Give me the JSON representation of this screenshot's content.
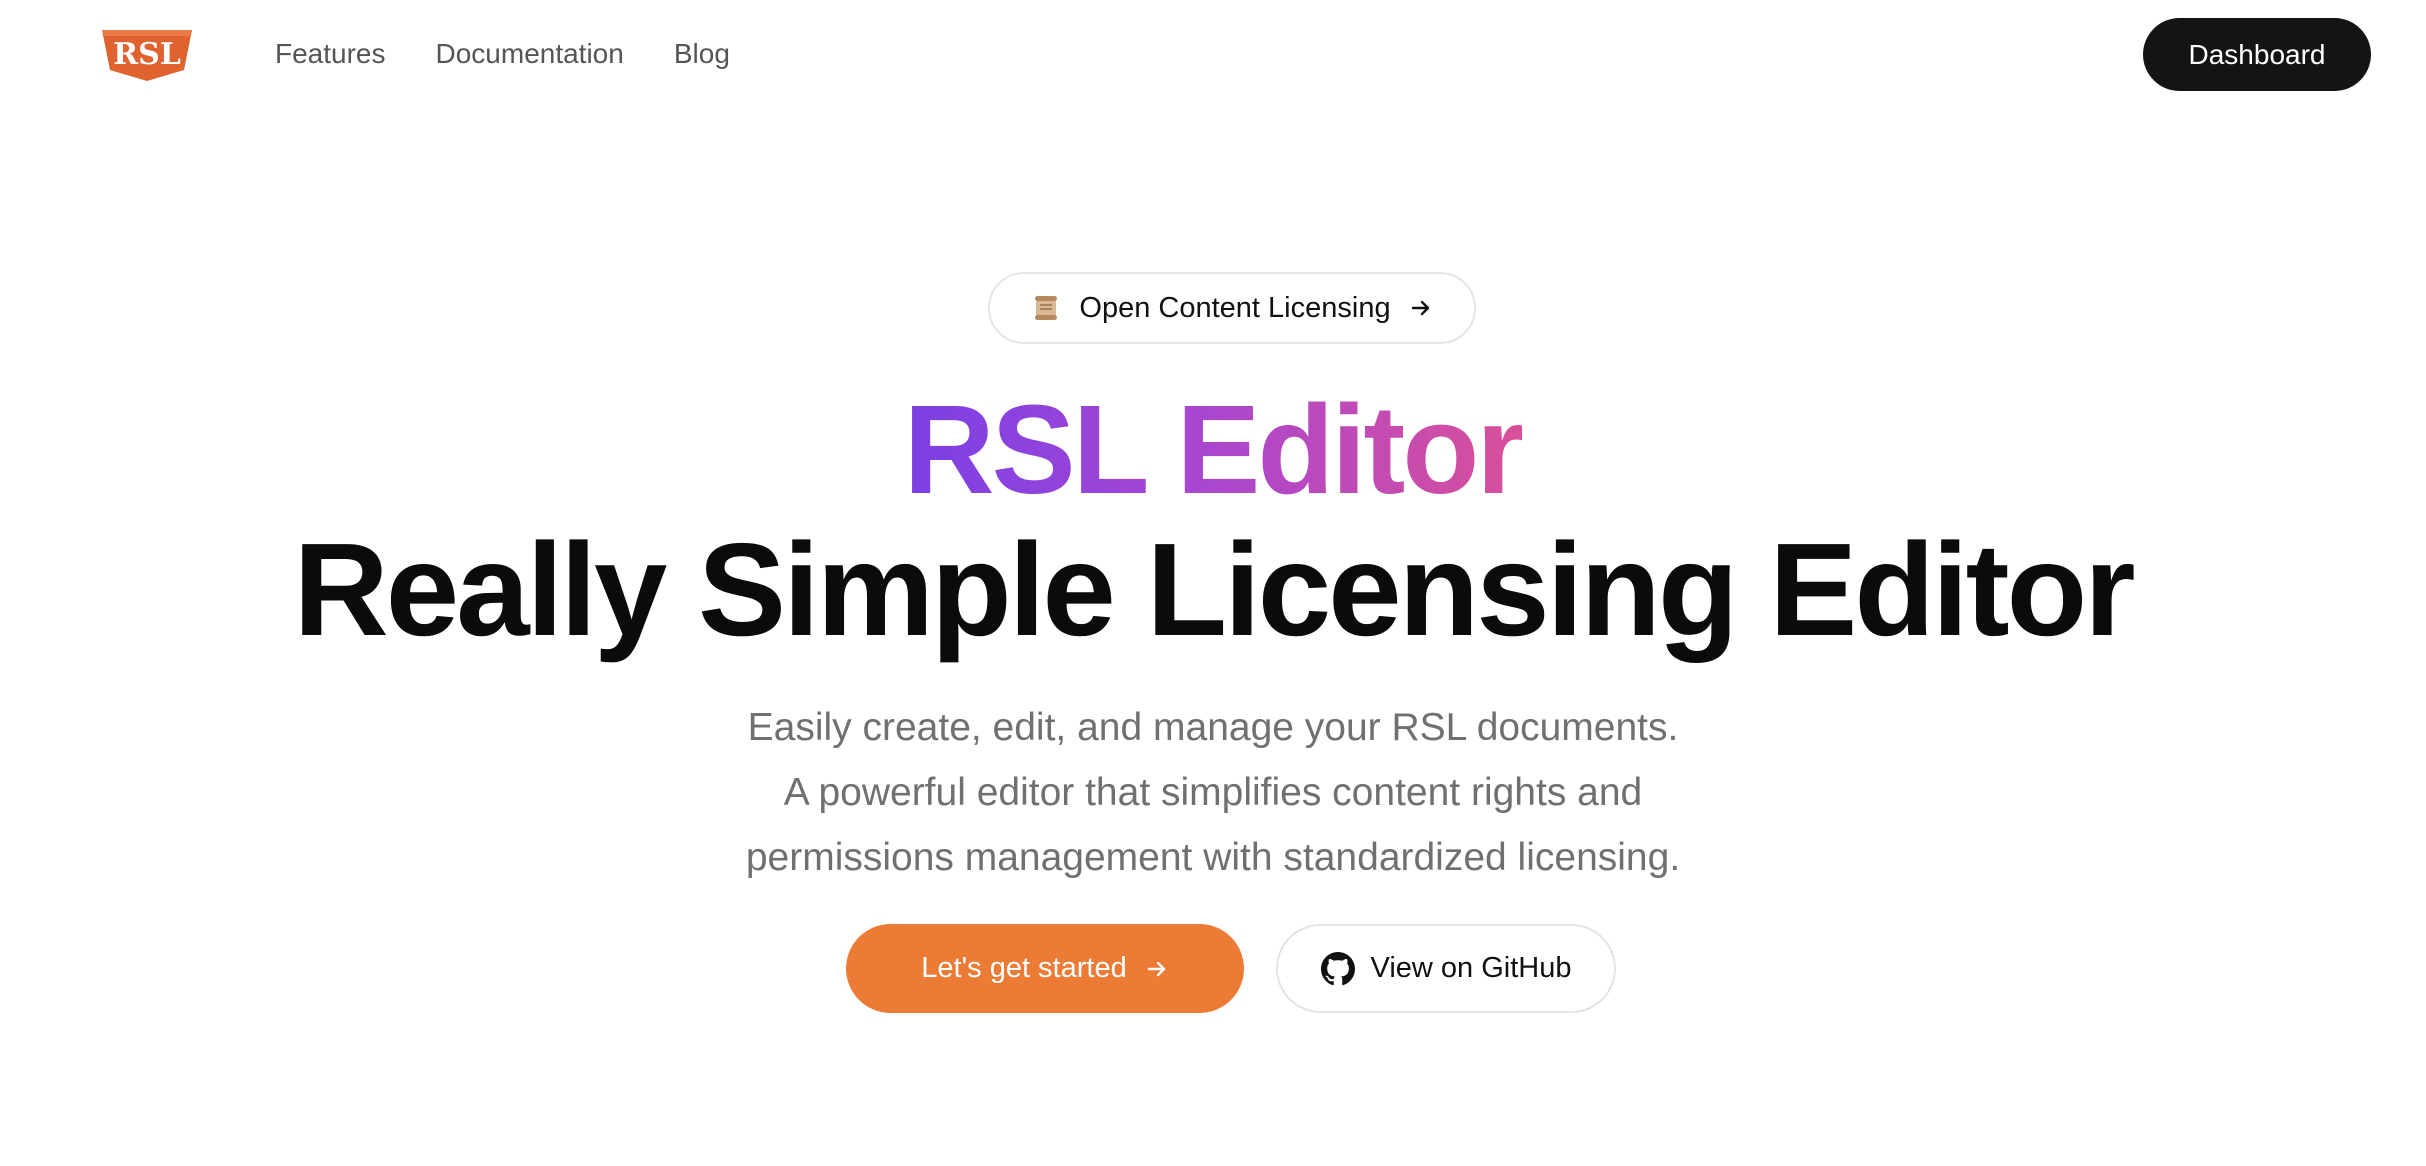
{
  "header": {
    "logo_text": "RSL",
    "nav": [
      {
        "label": "Features"
      },
      {
        "label": "Documentation"
      },
      {
        "label": "Blog"
      }
    ],
    "dashboard_label": "Dashboard"
  },
  "hero": {
    "badge": {
      "icon": "scroll-icon",
      "label": "Open Content Licensing",
      "arrow": "arrow-right-icon"
    },
    "title_gradient": "RSL Editor",
    "title_main": "Really Simple Licensing Editor",
    "subtitle_lines": [
      "Easily create, edit, and manage your RSL documents.",
      "A powerful editor that simplifies content rights and",
      "permissions management with standardized licensing."
    ],
    "primary_cta": "Let's get started",
    "secondary_cta": "View on GitHub"
  },
  "colors": {
    "logo": "#e0622e",
    "primary": "#ec7b35",
    "gradient_start": "#7b3fe4",
    "gradient_end": "#d94f9a",
    "dashboard_bg": "#141414"
  }
}
